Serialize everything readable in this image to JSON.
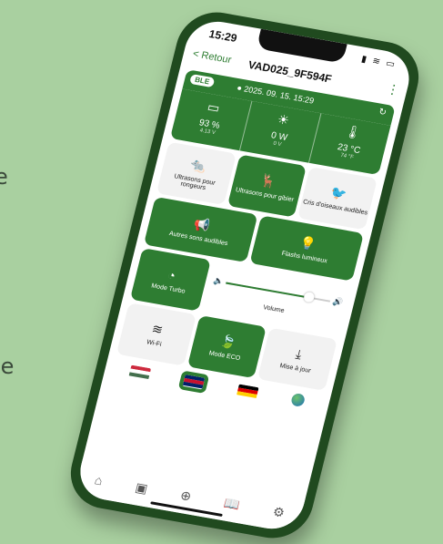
{
  "background": {
    "color": "#a9d0a0",
    "edge_chars": [
      "e",
      "le"
    ]
  },
  "status": {
    "time": "15:29"
  },
  "nav": {
    "back": "< Retour",
    "title": "VAD025_9F594F",
    "menu_icon": "kebab-icon"
  },
  "sync": {
    "ble": "BLE",
    "date": "2025. 09. 15. 15:29"
  },
  "sensors": [
    {
      "icon": "battery-icon",
      "value": "93 %",
      "sub": "4.13 V"
    },
    {
      "icon": "sun-icon",
      "value": "0 W",
      "sub": "0 V"
    },
    {
      "icon": "thermometer-icon",
      "value": "23 °C",
      "sub": "74 °F"
    }
  ],
  "modes_row1": [
    {
      "label": "Ultrasons pour rongeurs",
      "icon": "rodent-icon",
      "active": false
    },
    {
      "label": "Ultrasons pour gibier",
      "icon": "deer-icon",
      "active": true
    },
    {
      "label": "Cris d'oiseaux audibles",
      "icon": "bird-icon",
      "active": false
    }
  ],
  "modes_row2": [
    {
      "label": "Autres sons audibles",
      "icon": "megaphone-icon",
      "active": true
    },
    {
      "label": "Flashs lumineux",
      "icon": "bulb-icon",
      "active": true
    }
  ],
  "turbo": {
    "label": "Mode Turbo",
    "active": true
  },
  "volume": {
    "label": "Volume",
    "level": 0.8
  },
  "modes_row4": [
    {
      "label": "Wi-Fi",
      "icon": "wifi-icon",
      "active": false
    },
    {
      "label": "Mode ECO",
      "icon": "leaf-icon",
      "active": true
    },
    {
      "label": "Mise à jour",
      "icon": "download-icon",
      "active": false
    }
  ],
  "languages": [
    "hungarian",
    "english",
    "german",
    "globe"
  ],
  "selected_language": "english",
  "colors": {
    "accent": "#2e7d32",
    "phone": "#204a1f"
  }
}
